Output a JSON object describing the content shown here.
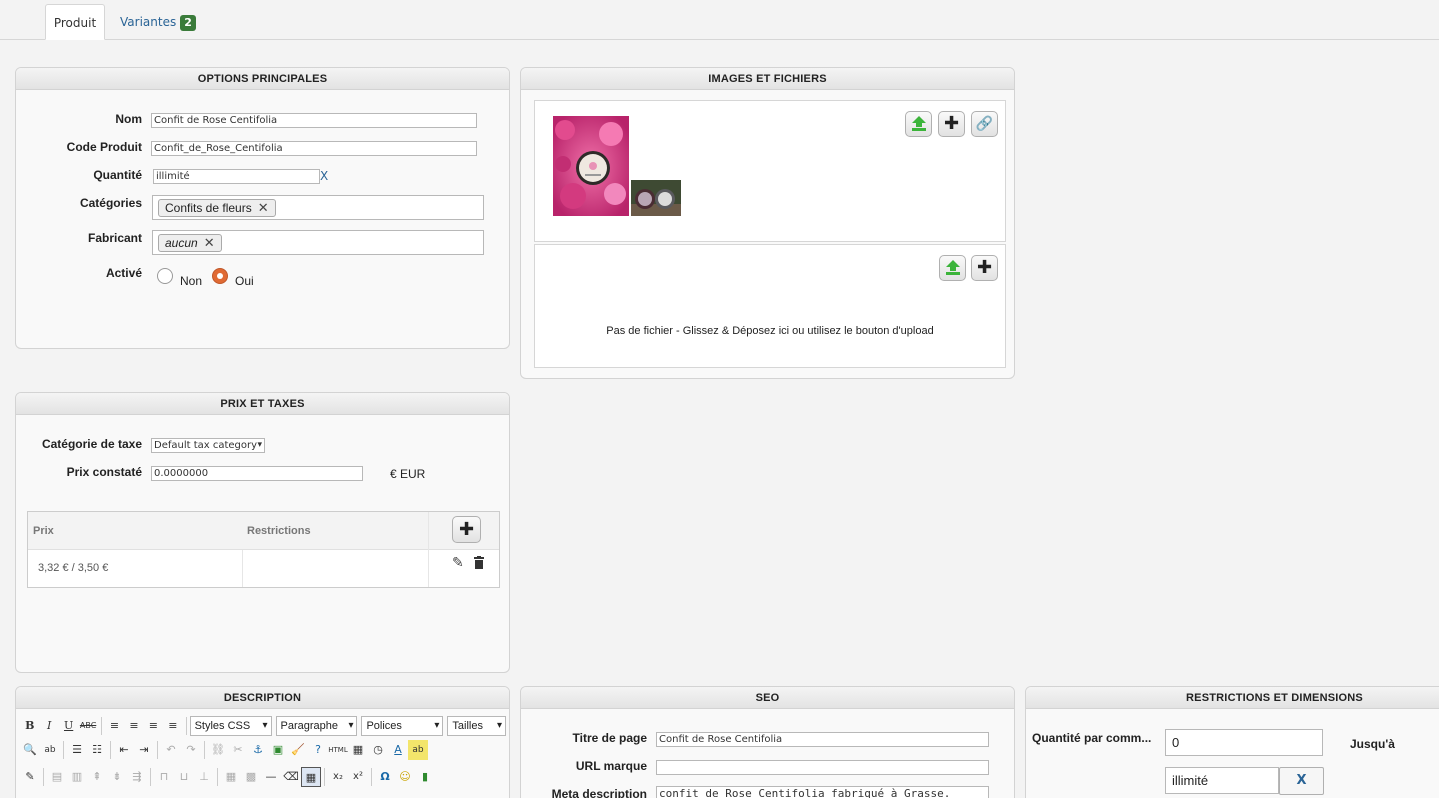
{
  "tabs": {
    "product": "Produit",
    "variants": "Variantes",
    "variants_count": "2"
  },
  "options": {
    "title": "OPTIONS PRINCIPALES",
    "name_label": "Nom",
    "name_value": "Confit de Rose Centifolia",
    "code_label": "Code Produit",
    "code_value": "Confit_de_Rose_Centifolia",
    "qty_label": "Quantité",
    "qty_value": "illimité",
    "qty_clear": "X",
    "cat_label": "Catégories",
    "cat_tag": "Confits de fleurs",
    "maker_label": "Fabricant",
    "maker_tag": "aucun",
    "active_label": "Activé",
    "active_no": "Non",
    "active_yes": "Oui",
    "active_selected": "Oui"
  },
  "images": {
    "title": "IMAGES ET FICHIERS",
    "no_file_text": "Pas de fichier - Glissez & Déposez ici ou utilisez le bouton d'upload"
  },
  "prices": {
    "title": "PRIX ET TAXES",
    "tax_label": "Catégorie de taxe",
    "tax_value": "Default tax category",
    "listed_label": "Prix constaté",
    "listed_value": "0.0000000",
    "currency": "€ EUR",
    "col_price": "Prix",
    "col_restrictions": "Restrictions",
    "rows": [
      {
        "price": "3,32 € / 3,50 €",
        "restrictions": ""
      }
    ]
  },
  "description": {
    "title": "DESCRIPTION",
    "styles_select": "Styles CSS",
    "paragraph_select": "Paragraphe",
    "fonts_select": "Polices",
    "sizes_select": "Tailles"
  },
  "seo": {
    "title": "SEO",
    "page_title_label": "Titre de page",
    "page_title_value": "Confit de Rose Centifolia",
    "url_label": "URL marque",
    "url_value": "",
    "meta_label": "Meta description",
    "meta_value": "confit de Rose Centifolia fabriqué à Grasse."
  },
  "restrictions": {
    "title": "RESTRICTIONS ET DIMENSIONS",
    "qty_per_order_label": "Quantité par comm...",
    "min_value": "0",
    "until_label": "Jusqu'à",
    "max_value": "illimité",
    "clear_label": "X"
  },
  "colors": {
    "accent": "#e06a34",
    "link": "#2a6496",
    "badge": "#3a7b3a",
    "upload_green": "#3bb43a"
  }
}
